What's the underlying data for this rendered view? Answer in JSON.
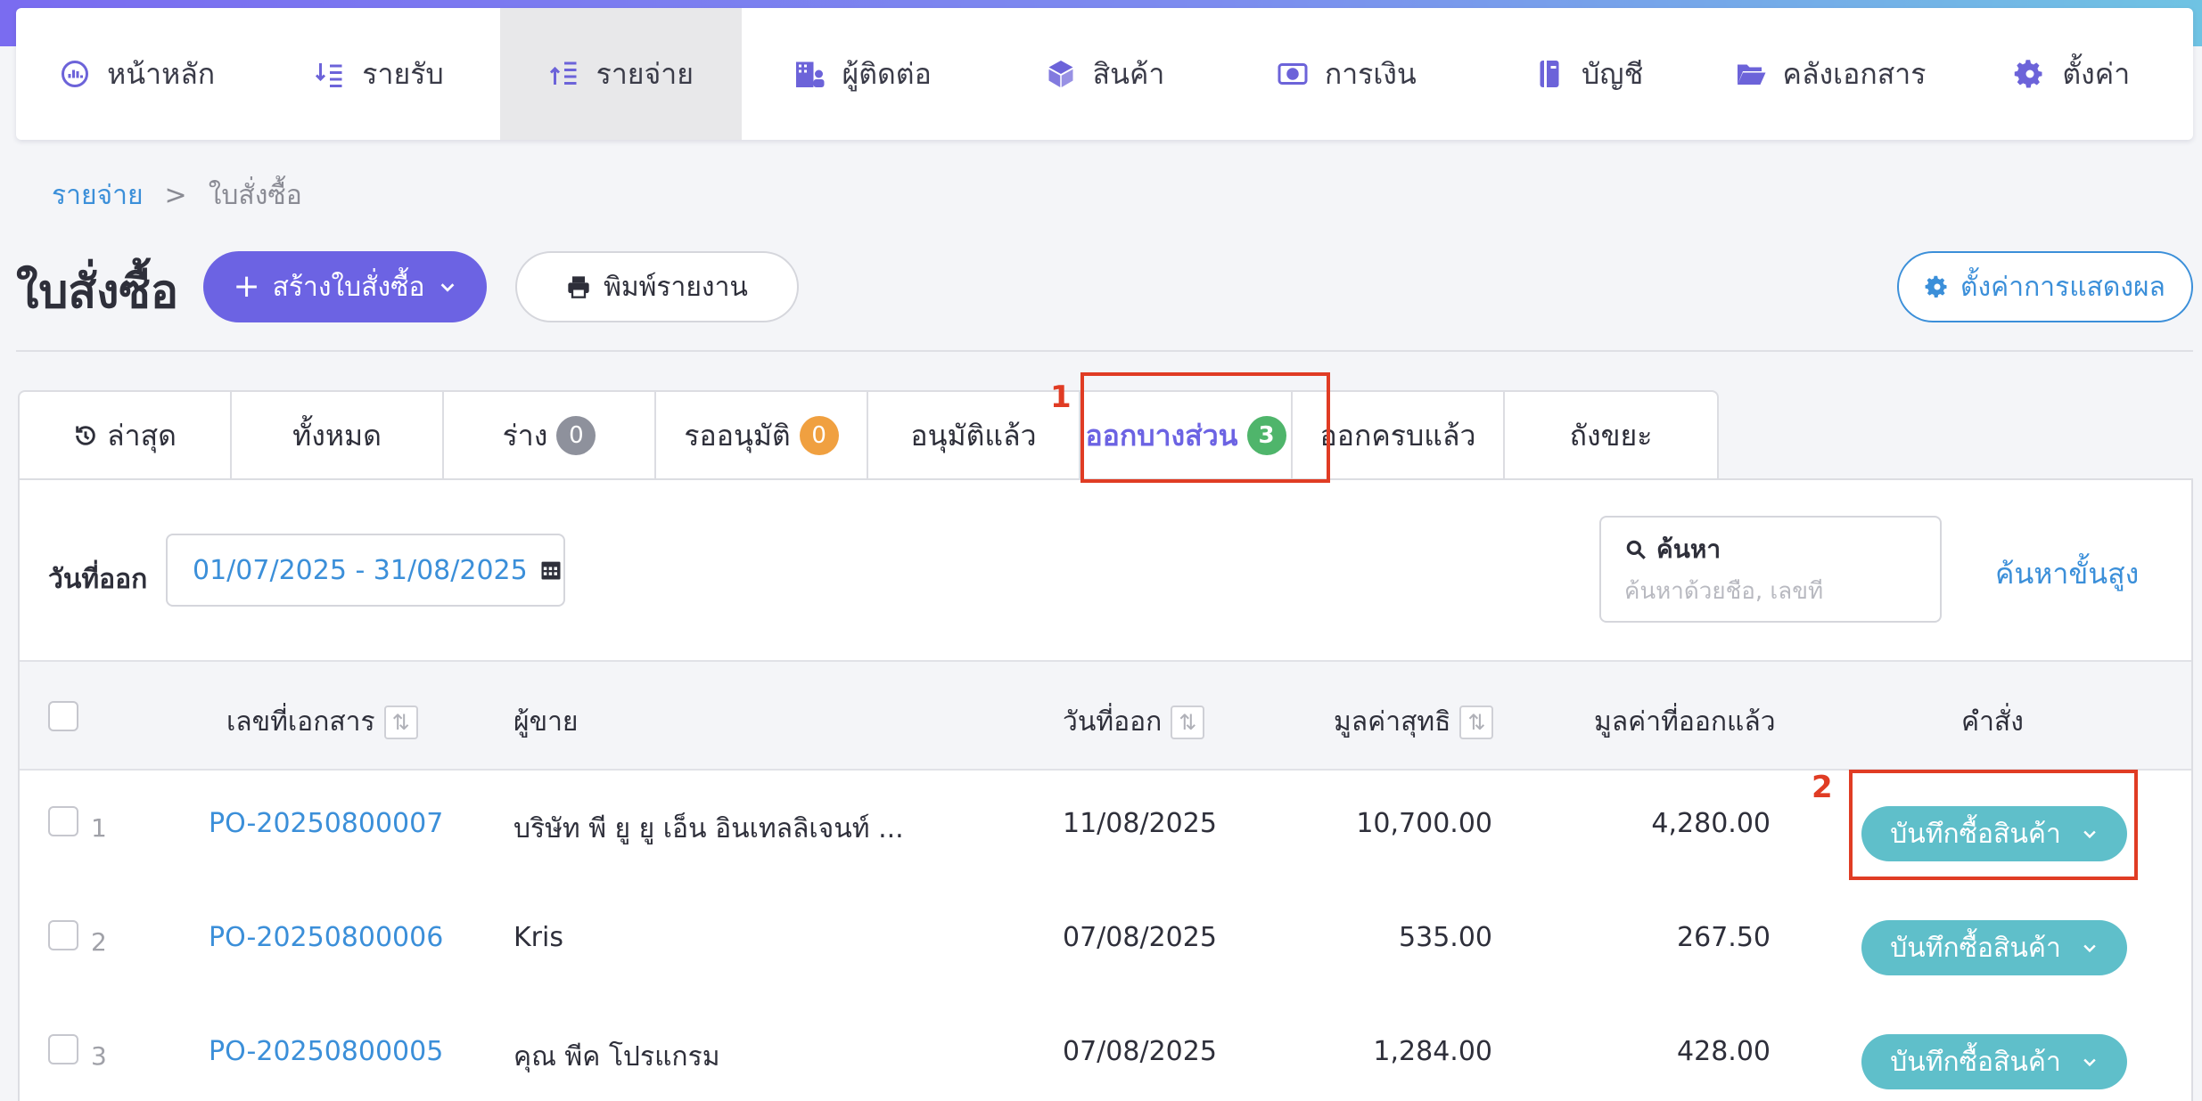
{
  "nav": {
    "items": [
      {
        "label": "หน้าหลัก",
        "icon": "dashboard-icon"
      },
      {
        "label": "รายรับ",
        "icon": "income-icon"
      },
      {
        "label": "รายจ่าย",
        "icon": "expense-icon"
      },
      {
        "label": "ผู้ติดต่อ",
        "icon": "contacts-icon"
      },
      {
        "label": "สินค้า",
        "icon": "box-icon"
      },
      {
        "label": "การเงิน",
        "icon": "money-icon"
      },
      {
        "label": "บัญชี",
        "icon": "book-icon"
      },
      {
        "label": "คลังเอกสาร",
        "icon": "folder-icon"
      },
      {
        "label": "ตั้งค่า",
        "icon": "gear-icon"
      }
    ],
    "active_index": 2
  },
  "breadcrumb": {
    "parent": "รายจ่าย",
    "separator": ">",
    "current": "ใบสั่งซื้อ"
  },
  "page_title": "ใบสั่งซื้อ",
  "toolbar": {
    "create_label": "สร้างใบสั่งซื้อ",
    "print_label": "พิมพ์รายงาน",
    "display_settings_label": "ตั้งค่าการแสดงผล"
  },
  "tabs": {
    "recent": "ล่าสุด",
    "all": "ทั้งหมด",
    "draft": "ร่าง",
    "draft_count": "0",
    "pending": "รออนุมัติ",
    "pending_count": "0",
    "approved": "อนุมัติแล้ว",
    "partial": "ออกบางส่วน",
    "partial_count": "3",
    "complete": "ออกครบแล้ว",
    "trash": "ถังขยะ"
  },
  "filter": {
    "date_label": "วันที่ออก",
    "date_range": "01/07/2025 - 31/08/2025",
    "search_title": "ค้นหา",
    "search_placeholder": "ค้นหาด้วยชื่อ, เลขที่",
    "advanced_search": "ค้นหาขั้นสูง"
  },
  "table": {
    "headers": {
      "doc_no": "เลขที่เอกสาร",
      "vendor": "ผู้ขาย",
      "date": "วันที่ออก",
      "net_value": "มูลค่าสุทธิ",
      "issued_value": "มูลค่าที่ออกแล้ว",
      "action": "คำสั่ง"
    },
    "rows": [
      {
        "num": "1",
        "doc_no": "PO-20250800007",
        "vendor": "บริษัท พี ยู ยู เอ็น อินเทลลิเจนท์ ...",
        "date": "11/08/2025",
        "net_value": "10,700.00",
        "issued_value": "4,280.00",
        "action": "บันทึกซื้อสินค้า"
      },
      {
        "num": "2",
        "doc_no": "PO-20250800006",
        "vendor": "Kris",
        "date": "07/08/2025",
        "net_value": "535.00",
        "issued_value": "267.50",
        "action": "บันทึกซื้อสินค้า"
      },
      {
        "num": "3",
        "doc_no": "PO-20250800005",
        "vendor": "คุณ พีค โปรแกรม",
        "date": "07/08/2025",
        "net_value": "1,284.00",
        "issued_value": "428.00",
        "action": "บันทึกซื้อสินค้า"
      }
    ]
  },
  "annotations": {
    "first": "1",
    "second": "2"
  },
  "colors": {
    "primary": "#6c63e3",
    "link": "#3b8fd9",
    "action": "#5fbfca",
    "highlight": "#e03c24"
  }
}
